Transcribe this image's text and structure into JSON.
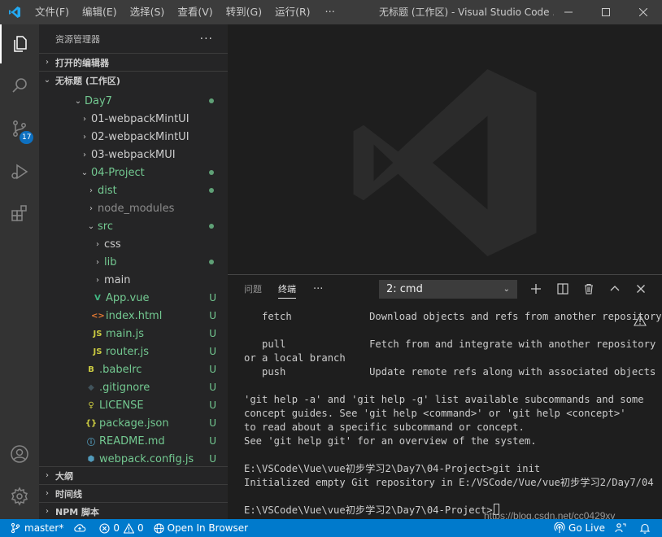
{
  "titlebar": {
    "menu": [
      "文件(F)",
      "编辑(E)",
      "选择(S)",
      "查看(V)",
      "转到(G)",
      "运行(R)"
    ],
    "more": "···",
    "window_title": "无标题 (工作区) - Visual Studio Code ..."
  },
  "activity": {
    "source_control_badge": "17"
  },
  "sidebar": {
    "title": "资源管理器",
    "more": "···",
    "open_editors": "打开的编辑器",
    "workspace": "无标题 (工作区)",
    "tree": [
      {
        "label": "Day7",
        "twist": "⌄",
        "icon": "",
        "deco": "dot"
      },
      {
        "label": "01-webpackMintUI",
        "twist": "›",
        "icon": "",
        "deco": ""
      },
      {
        "label": "02-webpackMintUI",
        "twist": "›",
        "icon": "",
        "deco": ""
      },
      {
        "label": "03-webpackMUI",
        "twist": "›",
        "icon": "",
        "deco": ""
      },
      {
        "label": "04-Project",
        "twist": "⌄",
        "icon": "",
        "deco": "dot"
      },
      {
        "label": "dist",
        "twist": "›",
        "icon": "",
        "deco": "dot"
      },
      {
        "label": "node_modules",
        "twist": "›",
        "icon": "",
        "deco": ""
      },
      {
        "label": "src",
        "twist": "⌄",
        "icon": "",
        "deco": "dot"
      },
      {
        "label": "css",
        "twist": "›",
        "icon": "",
        "deco": ""
      },
      {
        "label": "lib",
        "twist": "›",
        "icon": "",
        "deco": "dot"
      },
      {
        "label": "main",
        "twist": "›",
        "icon": "",
        "deco": ""
      },
      {
        "label": "App.vue",
        "twist": "",
        "icon": "V",
        "deco": "U"
      },
      {
        "label": "index.html",
        "twist": "",
        "icon": "<>",
        "deco": "U"
      },
      {
        "label": "main.js",
        "twist": "",
        "icon": "JS",
        "deco": "U"
      },
      {
        "label": "router.js",
        "twist": "",
        "icon": "JS",
        "deco": "U"
      },
      {
        "label": ".babelrc",
        "twist": "",
        "icon": "B",
        "deco": "U"
      },
      {
        "label": ".gitignore",
        "twist": "",
        "icon": "◆",
        "deco": "U"
      },
      {
        "label": "LICENSE",
        "twist": "",
        "icon": "♀",
        "deco": "U"
      },
      {
        "label": "package.json",
        "twist": "",
        "icon": "{}",
        "deco": "U"
      },
      {
        "label": "README.md",
        "twist": "",
        "icon": "ⓘ",
        "deco": "U"
      },
      {
        "label": "webpack.config.js",
        "twist": "",
        "icon": "⬢",
        "deco": "U"
      }
    ],
    "outline": "大纲",
    "timeline": "时间线",
    "npm": "NPM 脚本"
  },
  "panel": {
    "tab_problems": "问题",
    "tab_terminal": "终端",
    "more": "···",
    "terminal_select": "2: cmd",
    "lines": [
      "   fetch             Download objects and refs from another repository",
      "",
      "   pull              Fetch from and integrate with another repository",
      "or a local branch",
      "   push              Update remote refs along with associated objects",
      "",
      "'git help -a' and 'git help -g' list available subcommands and some",
      "concept guides. See 'git help <command>' or 'git help <concept>'",
      "to read about a specific subcommand or concept.",
      "See 'git help git' for an overview of the system.",
      "",
      "E:\\VSCode\\Vue\\vue初步学习2\\Day7\\04-Project>git init",
      "Initialized empty Git repository in E:/VSCode/Vue/vue初步学习2/Day7/04",
      "",
      "E:\\VSCode\\Vue\\vue初步学习2\\Day7\\04-Project>"
    ],
    "blog_watermark": "https://blog.csdn.net/cc0429xy"
  },
  "statusbar": {
    "branch": "master*",
    "errors": "0",
    "warnings": "0",
    "open_in_browser": "Open In Browser",
    "go_live": "Go Live"
  },
  "colors": {
    "accent": "#007acc",
    "git_untracked": "#73c991",
    "vscode_blue": "#23a9f2"
  }
}
